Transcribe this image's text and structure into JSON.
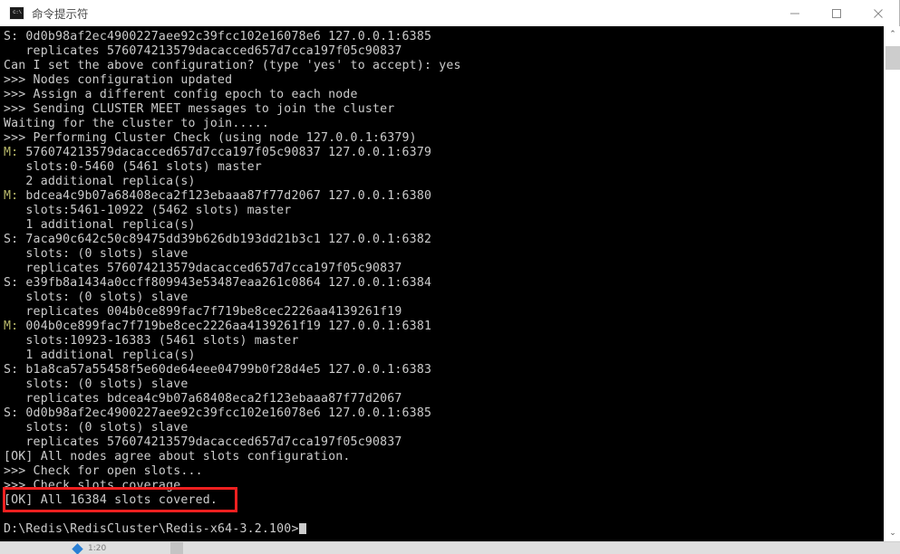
{
  "window": {
    "title": "命令提示符",
    "icon_name": "cmd-icon",
    "icon_glyph": "C:\\",
    "buttons": {
      "minimize": "−",
      "maximize": "□",
      "close": "✕"
    }
  },
  "colors": {
    "terminal_bg": "#000000",
    "terminal_fg": "#cccccc",
    "master_tag": "#b9b96a",
    "annotation": "#f02020",
    "titlebar_bg": "#ffffff"
  },
  "terminal": {
    "lines": [
      {
        "tag": "S:",
        "tag_type": "slave",
        "text": " 0d0b98af2ec4900227aee92c39fcc102e16078e6 127.0.0.1:6385"
      },
      {
        "tag": "",
        "tag_type": "none",
        "text": "   replicates 576074213579dacacced657d7cca197f05c90837"
      },
      {
        "tag": "",
        "tag_type": "none",
        "text": "Can I set the above configuration? (type 'yes' to accept): yes"
      },
      {
        "tag": "",
        "tag_type": "none",
        "text": ">>> Nodes configuration updated"
      },
      {
        "tag": "",
        "tag_type": "none",
        "text": ">>> Assign a different config epoch to each node"
      },
      {
        "tag": "",
        "tag_type": "none",
        "text": ">>> Sending CLUSTER MEET messages to join the cluster"
      },
      {
        "tag": "",
        "tag_type": "none",
        "text": "Waiting for the cluster to join....."
      },
      {
        "tag": "",
        "tag_type": "none",
        "text": ">>> Performing Cluster Check (using node 127.0.0.1:6379)"
      },
      {
        "tag": "M:",
        "tag_type": "master",
        "text": " 576074213579dacacced657d7cca197f05c90837 127.0.0.1:6379"
      },
      {
        "tag": "",
        "tag_type": "none",
        "text": "   slots:0-5460 (5461 slots) master"
      },
      {
        "tag": "",
        "tag_type": "none",
        "text": "   2 additional replica(s)"
      },
      {
        "tag": "M:",
        "tag_type": "master",
        "text": " bdcea4c9b07a68408eca2f123ebaaa87f77d2067 127.0.0.1:6380"
      },
      {
        "tag": "",
        "tag_type": "none",
        "text": "   slots:5461-10922 (5462 slots) master"
      },
      {
        "tag": "",
        "tag_type": "none",
        "text": "   1 additional replica(s)"
      },
      {
        "tag": "S:",
        "tag_type": "slave",
        "text": " 7aca90c642c50c89475dd39b626db193dd21b3c1 127.0.0.1:6382"
      },
      {
        "tag": "",
        "tag_type": "none",
        "text": "   slots: (0 slots) slave"
      },
      {
        "tag": "",
        "tag_type": "none",
        "text": "   replicates 576074213579dacacced657d7cca197f05c90837"
      },
      {
        "tag": "S:",
        "tag_type": "slave",
        "text": " e39fb8a1434a0ccff809943e53487eaa261c0864 127.0.0.1:6384"
      },
      {
        "tag": "",
        "tag_type": "none",
        "text": "   slots: (0 slots) slave"
      },
      {
        "tag": "",
        "tag_type": "none",
        "text": "   replicates 004b0ce899fac7f719be8cec2226aa4139261f19"
      },
      {
        "tag": "M:",
        "tag_type": "master",
        "text": " 004b0ce899fac7f719be8cec2226aa4139261f19 127.0.0.1:6381"
      },
      {
        "tag": "",
        "tag_type": "none",
        "text": "   slots:10923-16383 (5461 slots) master"
      },
      {
        "tag": "",
        "tag_type": "none",
        "text": "   1 additional replica(s)"
      },
      {
        "tag": "S:",
        "tag_type": "slave",
        "text": " b1a8ca57a55458f5e60de64eee04799b0f28d4e5 127.0.0.1:6383"
      },
      {
        "tag": "",
        "tag_type": "none",
        "text": "   slots: (0 slots) slave"
      },
      {
        "tag": "",
        "tag_type": "none",
        "text": "   replicates bdcea4c9b07a68408eca2f123ebaaa87f77d2067"
      },
      {
        "tag": "S:",
        "tag_type": "slave",
        "text": " 0d0b98af2ec4900227aee92c39fcc102e16078e6 127.0.0.1:6385"
      },
      {
        "tag": "",
        "tag_type": "none",
        "text": "   slots: (0 slots) slave"
      },
      {
        "tag": "",
        "tag_type": "none",
        "text": "   replicates 576074213579dacacced657d7cca197f05c90837"
      },
      {
        "tag": "",
        "tag_type": "none",
        "text": "[OK] All nodes agree about slots configuration."
      },
      {
        "tag": "",
        "tag_type": "none",
        "text": ">>> Check for open slots..."
      },
      {
        "tag": "",
        "tag_type": "none",
        "text": ">>> Check slots coverage..."
      },
      {
        "tag": "",
        "tag_type": "none",
        "text": "[OK] All 16384 slots covered."
      },
      {
        "tag": "",
        "tag_type": "none",
        "text": ""
      },
      {
        "tag": "",
        "tag_type": "none",
        "text": "D:\\Redis\\RedisCluster\\Redis-x64-3.2.100>",
        "cursor": true
      }
    ]
  },
  "annotation": {
    "label": "highlight-ok-slots-covered",
    "target_text": "[OK] All 16384 slots covered."
  },
  "scrollbar": {
    "up_arrow": "⌃",
    "down_arrow": "⌄"
  },
  "taskbar": {
    "item_label": "1:20"
  }
}
